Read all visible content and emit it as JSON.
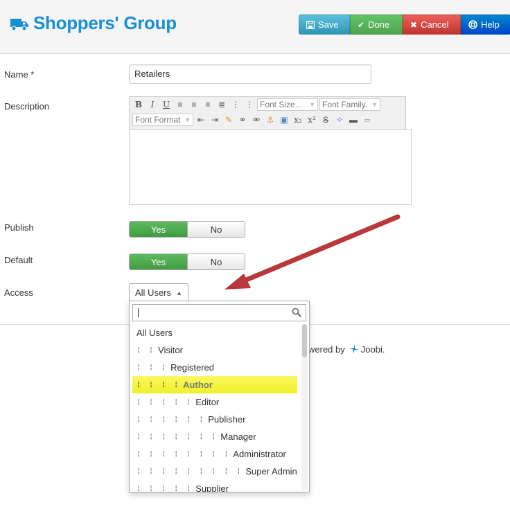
{
  "header": {
    "title": "Shoppers' Group",
    "toolbar": {
      "save_label": "Save",
      "done_label": "Done",
      "cancel_label": "Cancel",
      "help_label": "Help"
    }
  },
  "form": {
    "name_label": "Name *",
    "name_value": "Retailers",
    "description_label": "Description",
    "editor": {
      "font_size": "Font Size...",
      "font_family": "Font Family.",
      "font_format": "Font Format"
    },
    "publish_label": "Publish",
    "publish_yes": "Yes",
    "publish_no": "No",
    "default_label": "Default",
    "default_yes": "Yes",
    "default_no": "No",
    "access_label": "Access",
    "access_value": "All Users"
  },
  "footer": {
    "powered_text": "wered by",
    "brand": "Joobi."
  },
  "access_dropdown": {
    "search_value": "",
    "options": [
      {
        "prefix": "",
        "label": "All Users"
      },
      {
        "prefix": "¦ ¦",
        "label": "Visitor"
      },
      {
        "prefix": "¦ ¦ ¦",
        "label": "Registered"
      },
      {
        "prefix": "¦ ¦ ¦ ¦",
        "label": "Author"
      },
      {
        "prefix": "¦ ¦ ¦ ¦ ¦",
        "label": "Editor"
      },
      {
        "prefix": "¦ ¦ ¦ ¦ ¦ ¦",
        "label": "Publisher"
      },
      {
        "prefix": "¦ ¦ ¦ ¦ ¦ ¦ ¦",
        "label": "Manager"
      },
      {
        "prefix": "¦ ¦ ¦ ¦ ¦ ¦ ¦ ¦",
        "label": "Administrator"
      },
      {
        "prefix": "¦ ¦ ¦ ¦ ¦ ¦ ¦ ¦ ¦",
        "label": "Super Administrator"
      },
      {
        "prefix": "¦ ¦ ¦ ¦ ¦",
        "label": "Supplier"
      }
    ],
    "highlighted": "Author"
  },
  "colors": {
    "title": "#1a8fd6",
    "save": "#2f96b4",
    "done": "#51a351",
    "cancel": "#bd362f",
    "help": "#0044cc",
    "yes": "#419c41",
    "highlight": "#eef02b",
    "arrow": "#b8383b"
  },
  "icons": {
    "title_icon": "truck-icon",
    "save_icon": "floppy-icon",
    "done_icon": "check-icon",
    "cancel_icon": "x-icon",
    "help_icon": "lifebuoy-icon",
    "search_icon": "search-icon"
  }
}
